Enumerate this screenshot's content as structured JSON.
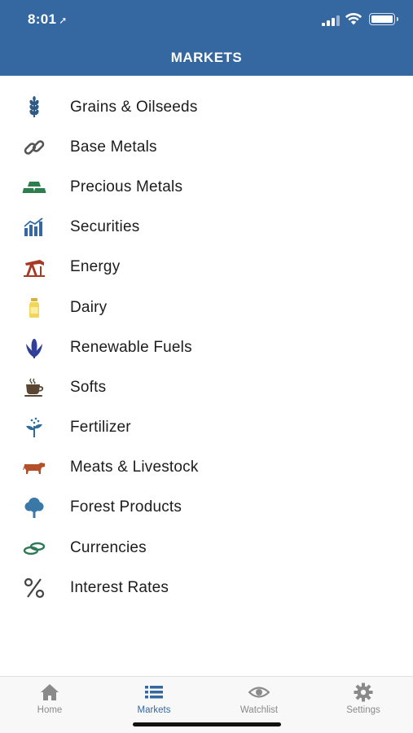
{
  "status_bar": {
    "time": "8:01",
    "location_arrow": "➚"
  },
  "header": {
    "title": "MARKETS"
  },
  "markets": [
    {
      "label": "Grains & Oilseeds",
      "icon": "wheat-icon",
      "color": "#2f5a87"
    },
    {
      "label": "Base Metals",
      "icon": "chain-link-icon",
      "color": "#555555"
    },
    {
      "label": "Precious Metals",
      "icon": "gold-bars-icon",
      "color": "#2e7d4f"
    },
    {
      "label": "Securities",
      "icon": "bar-chart-icon",
      "color": "#3567a1"
    },
    {
      "label": "Energy",
      "icon": "oil-pump-icon",
      "color": "#a63a24"
    },
    {
      "label": "Dairy",
      "icon": "milk-bottle-icon",
      "color": "#e8c53a"
    },
    {
      "label": "Renewable Fuels",
      "icon": "corn-icon",
      "color": "#2f3f9a"
    },
    {
      "label": "Softs",
      "icon": "coffee-cup-icon",
      "color": "#5a4633"
    },
    {
      "label": "Fertilizer",
      "icon": "seedling-icon",
      "color": "#2f6c9e"
    },
    {
      "label": "Meats & Livestock",
      "icon": "cow-icon",
      "color": "#b2502c"
    },
    {
      "label": "Forest Products",
      "icon": "tree-icon",
      "color": "#3a78a8"
    },
    {
      "label": "Currencies",
      "icon": "coins-icon",
      "color": "#2e7a58"
    },
    {
      "label": "Interest Rates",
      "icon": "percent-icon",
      "color": "#444444"
    }
  ],
  "tabbar": {
    "home": "Home",
    "markets": "Markets",
    "watchlist": "Watchlist",
    "settings": "Settings",
    "active_color": "#3567a1",
    "inactive_color": "#8a8a8a"
  }
}
